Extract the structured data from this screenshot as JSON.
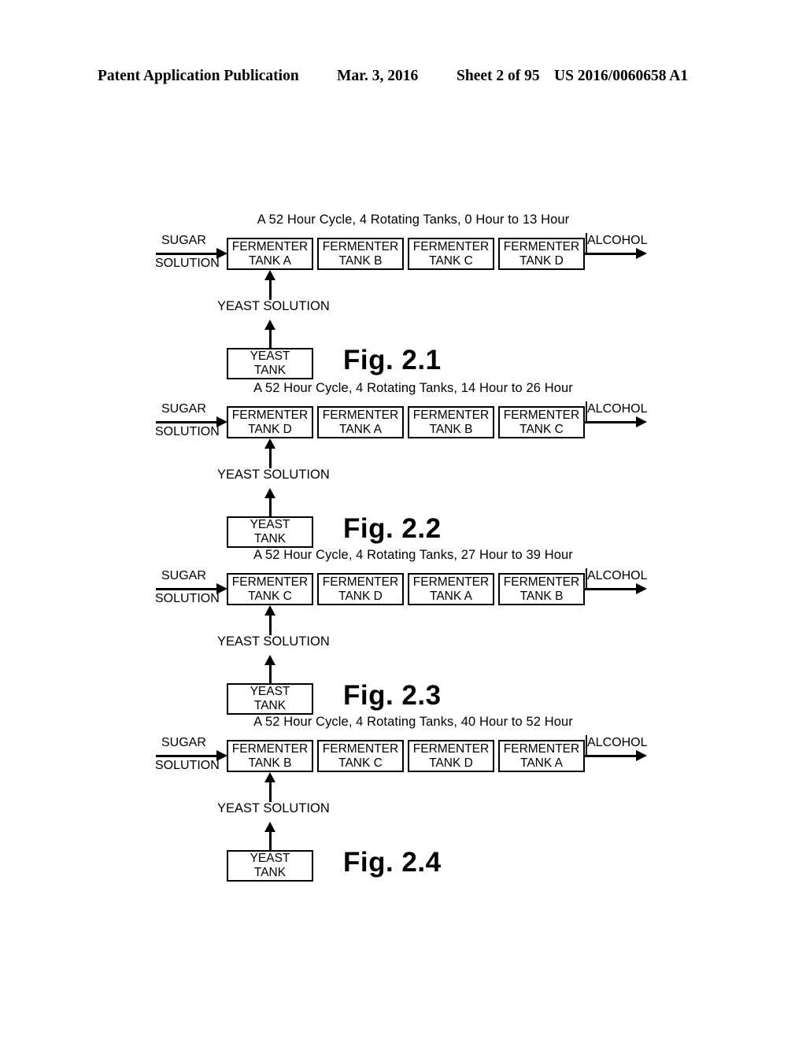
{
  "header": {
    "title": "Patent Application Publication",
    "date": "Mar. 3, 2016",
    "sheet": "Sheet 2 of 95",
    "number": "US 2016/0060658 A1"
  },
  "labels": {
    "sugar_top": "SUGAR",
    "sugar_bottom": "SOLUTION",
    "alcohol": "ALCOHOL",
    "yeast_solution": "YEAST SOLUTION",
    "yeast_tank_line1": "YEAST",
    "yeast_tank_line2": "TANK",
    "fermenter": "FERMENTER"
  },
  "figures": [
    {
      "title": "A 52 Hour Cycle, 4 Rotating Tanks, 0 Hour to 13 Hour",
      "caption": "Fig. 2.1",
      "tanks": [
        {
          "line1": "FERMENTER",
          "line2": "TANK A"
        },
        {
          "line1": "FERMENTER",
          "line2": "TANK B"
        },
        {
          "line1": "FERMENTER",
          "line2": "TANK C"
        },
        {
          "line1": "FERMENTER",
          "line2": "TANK D"
        }
      ]
    },
    {
      "title": "A 52 Hour Cycle, 4 Rotating Tanks, 14 Hour to 26 Hour",
      "caption": "Fig. 2.2",
      "tanks": [
        {
          "line1": "FERMENTER",
          "line2": "TANK D"
        },
        {
          "line1": "FERMENTER",
          "line2": "TANK A"
        },
        {
          "line1": "FERMENTER",
          "line2": "TANK B"
        },
        {
          "line1": "FERMENTER",
          "line2": "TANK C"
        }
      ]
    },
    {
      "title": "A 52 Hour Cycle, 4 Rotating Tanks, 27 Hour to 39 Hour",
      "caption": "Fig. 2.3",
      "tanks": [
        {
          "line1": "FERMENTER",
          "line2": "TANK C"
        },
        {
          "line1": "FERMENTER",
          "line2": "TANK D"
        },
        {
          "line1": "FERMENTER",
          "line2": "TANK A"
        },
        {
          "line1": "FERMENTER",
          "line2": "TANK B"
        }
      ]
    },
    {
      "title": "A 52 Hour Cycle, 4 Rotating Tanks, 40 Hour to 52 Hour",
      "caption": "Fig. 2.4",
      "tanks": [
        {
          "line1": "FERMENTER",
          "line2": "TANK B"
        },
        {
          "line1": "FERMENTER",
          "line2": "TANK C"
        },
        {
          "line1": "FERMENTER",
          "line2": "TANK D"
        },
        {
          "line1": "FERMENTER",
          "line2": "TANK A"
        }
      ]
    }
  ]
}
